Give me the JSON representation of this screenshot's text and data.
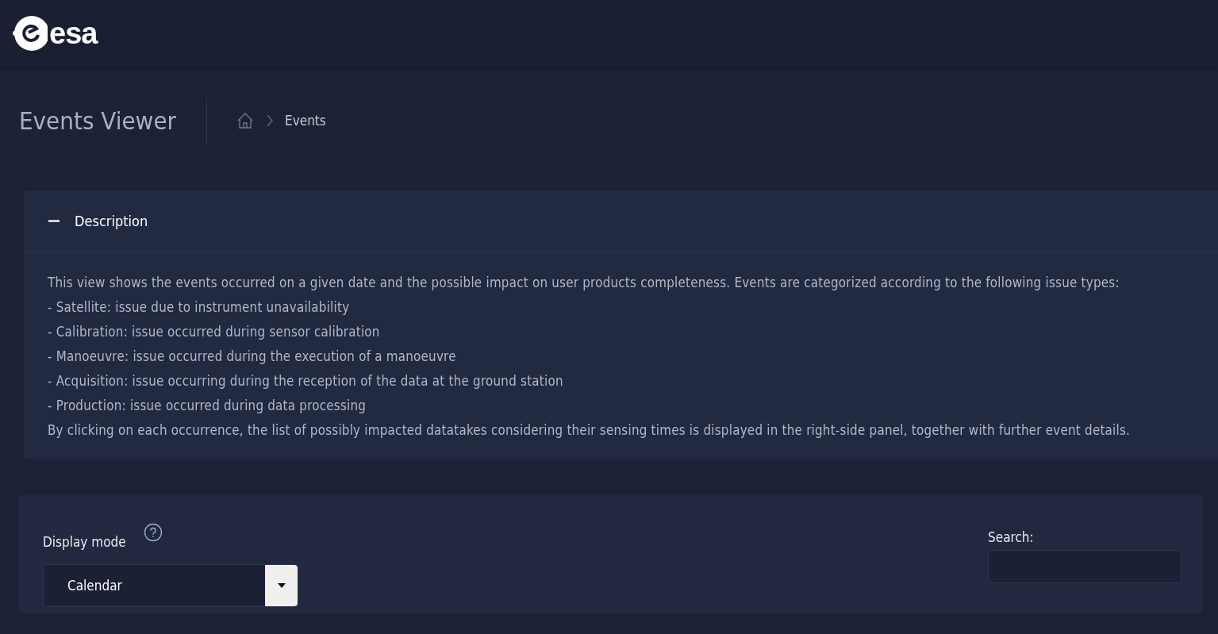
{
  "header": {
    "logo": "esa"
  },
  "page": {
    "title": "Events Viewer",
    "breadcrumb": [
      "Events"
    ]
  },
  "description": {
    "title": "Description",
    "expanded": true,
    "lines": [
      "This view shows the events occurred on a given date and the possible impact on user products completeness. Events are categorized according to the following issue types:",
      "- Satellite: issue due to instrument unavailability",
      "- Calibration: issue occurred during sensor calibration",
      "- Manoeuvre: issue occurred during the execution of a manoeuvre",
      "- Acquisition: issue occurring during the reception of the data at the ground station",
      "- Production: issue occurred during data processing",
      "By clicking on each occurrence, the list of possibly impacted datatakes considering their sensing times is displayed in the right-side panel, together with further event details."
    ]
  },
  "controls": {
    "display_mode": {
      "label": "Display mode",
      "value": "Calendar"
    },
    "search": {
      "label": "Search:"
    }
  }
}
